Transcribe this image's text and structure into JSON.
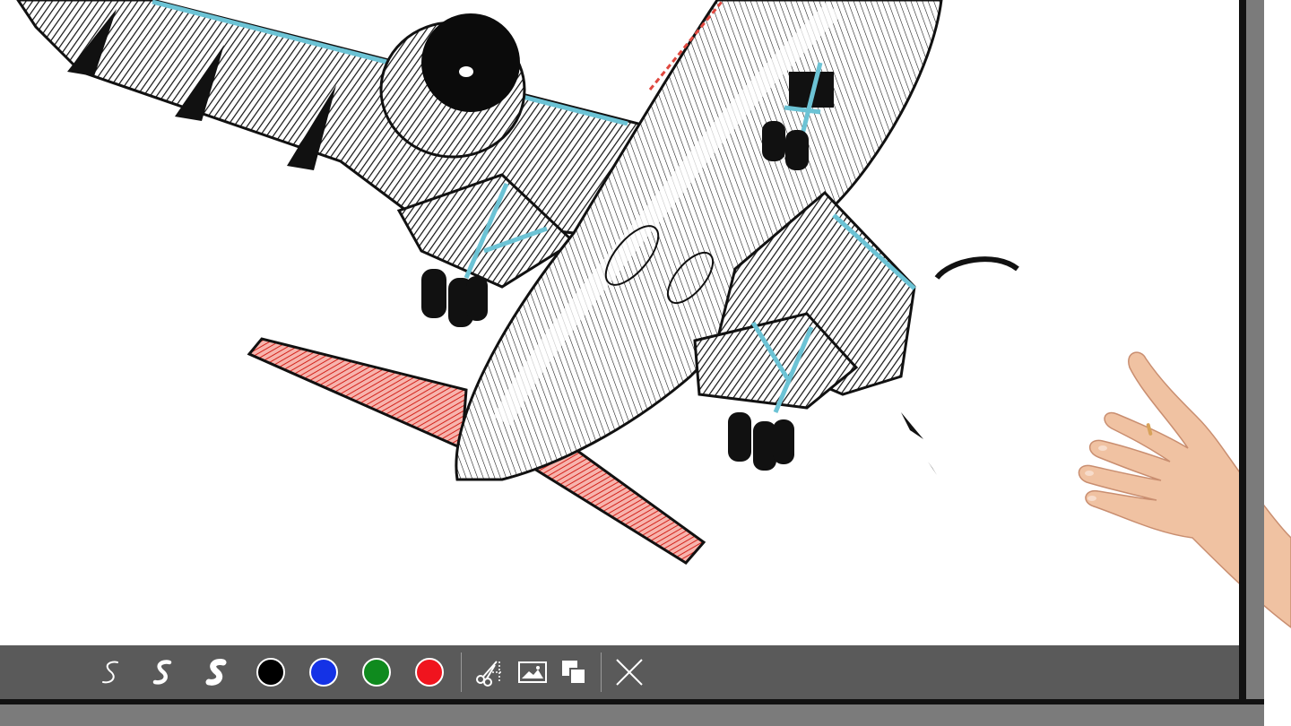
{
  "toolbar": {
    "pens": [
      {
        "name": "thin-pen",
        "icon": "pen-stroke-thin-icon"
      },
      {
        "name": "medium-pen",
        "icon": "pen-stroke-medium-icon"
      },
      {
        "name": "thick-pen",
        "icon": "pen-stroke-thick-icon"
      }
    ],
    "colors": [
      {
        "name": "black",
        "hex": "#000000"
      },
      {
        "name": "blue",
        "hex": "#1432e6"
      },
      {
        "name": "green",
        "hex": "#0f8a1e"
      },
      {
        "name": "red",
        "hex": "#f0141e"
      }
    ],
    "actions": [
      {
        "name": "screen-capture",
        "icon": "scissors-capture-icon"
      },
      {
        "name": "image",
        "icon": "image-icon"
      },
      {
        "name": "copy",
        "icon": "copy-icon"
      }
    ],
    "close": {
      "icon": "close-icon"
    }
  },
  "canvas": {
    "drawing_icon": "airplane-sketch",
    "drawing_colors": {
      "ink": "#111111",
      "highlight": "#6cc3d5",
      "tail": "#e0483f"
    }
  },
  "theme": {
    "toolbar_bg": "#5a5a5a",
    "bezel": "#7b7b7b",
    "bezel_edge": "#121212"
  }
}
